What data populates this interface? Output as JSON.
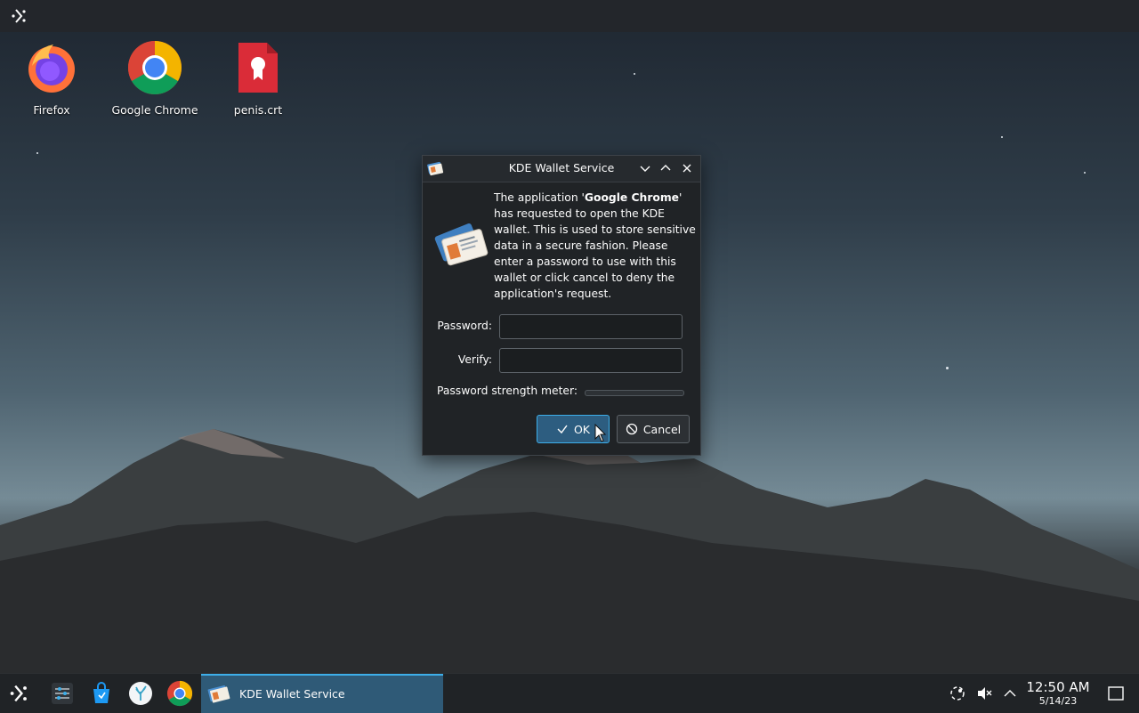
{
  "desktop": {
    "icons": [
      {
        "label": "Firefox"
      },
      {
        "label": "Google Chrome"
      },
      {
        "label": "penis.crt"
      }
    ]
  },
  "dialog": {
    "title": "KDE Wallet Service",
    "message_prefix": "The application '",
    "app_name": "Google Chrome",
    "message_suffix": "' has requested to open the KDE wallet. This is used to store sensitive data in a secure fashion. Please enter a password to use with this wallet or click cancel to deny the application's request.",
    "password_label": "Password:",
    "verify_label": "Verify:",
    "password_value": "",
    "verify_value": "",
    "strength_label": "Password strength meter:",
    "strength": 0,
    "ok_label": "OK",
    "cancel_label": "Cancel"
  },
  "taskbar": {
    "active_task": "KDE Wallet Service",
    "clock_time": "12:50 AM",
    "clock_date": "5/14/23"
  },
  "colors": {
    "accent": "#3daee9",
    "dialog_bg": "#202326",
    "taskbar_bg": "#202326"
  }
}
